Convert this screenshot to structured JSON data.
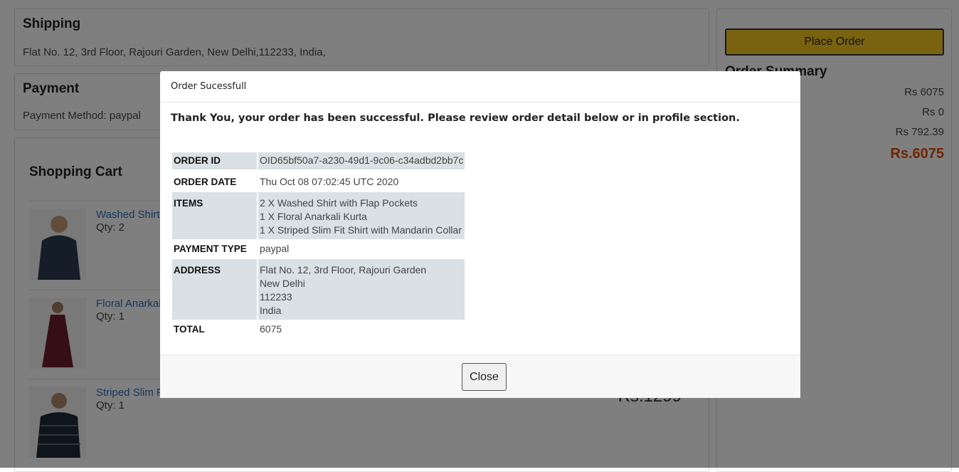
{
  "shipping": {
    "title": "Shipping",
    "address": "Flat No. 12, 3rd Floor, Rajouri Garden, New Delhi,112233, India,"
  },
  "payment": {
    "title": "Payment",
    "method": "Payment Method: paypal"
  },
  "cart": {
    "title": "Shopping Cart",
    "items": [
      {
        "name": "Washed Shirt with Flap Pockets",
        "qty": "Qty: 2",
        "price": ""
      },
      {
        "name": "Floral Anarkali Kurta",
        "qty": "Qty: 1",
        "price": ""
      },
      {
        "name": "Striped Slim Fit Shirt with Mandarin Collar",
        "qty": "Qty: 1",
        "price": "Rs.1299"
      }
    ]
  },
  "summary": {
    "place_order_label": "Place Order",
    "title": "Order Summary",
    "rows": [
      "Rs 6075",
      "Rs 0",
      "Rs 792.39"
    ],
    "total": "Rs.6075"
  },
  "modal": {
    "title": "Order Sucessfull",
    "message": "Thank You, your order has been successful. Please review order detail below or in profile section.",
    "order_id_label": "ORDER ID",
    "order_id": "OID65bf50a7-a230-49d1-9c06-c34adbd2bb7c",
    "order_date_label": "ORDER DATE",
    "order_date": "Thu Oct 08 07:02:45 UTC 2020",
    "items_label": "ITEMS",
    "items": [
      "2 X Washed Shirt with Flap Pockets",
      "1 X Floral Anarkali Kurta",
      "1 X Striped Slim Fit Shirt with Mandarin Collar"
    ],
    "payment_type_label": "PAYMENT TYPE",
    "payment_type": "paypal",
    "address_label": "ADDRESS",
    "address_lines": [
      "Flat No. 12, 3rd Floor, Rajouri Garden",
      "New Delhi",
      "112233",
      "India"
    ],
    "total_label": "TOTAL",
    "total": "6075",
    "close_label": "Close"
  }
}
